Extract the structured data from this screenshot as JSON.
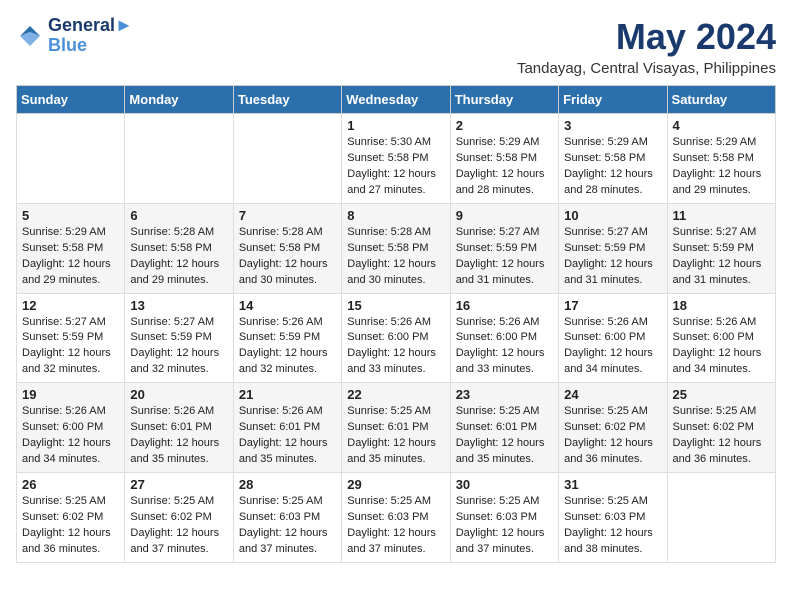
{
  "logo": {
    "line1": "General",
    "line2": "Blue"
  },
  "title": "May 2024",
  "subtitle": "Tandayag, Central Visayas, Philippines",
  "header": {
    "days": [
      "Sunday",
      "Monday",
      "Tuesday",
      "Wednesday",
      "Thursday",
      "Friday",
      "Saturday"
    ]
  },
  "weeks": [
    {
      "cells": [
        {
          "day": "",
          "info": ""
        },
        {
          "day": "",
          "info": ""
        },
        {
          "day": "",
          "info": ""
        },
        {
          "day": "1",
          "info": "Sunrise: 5:30 AM\nSunset: 5:58 PM\nDaylight: 12 hours\nand 27 minutes."
        },
        {
          "day": "2",
          "info": "Sunrise: 5:29 AM\nSunset: 5:58 PM\nDaylight: 12 hours\nand 28 minutes."
        },
        {
          "day": "3",
          "info": "Sunrise: 5:29 AM\nSunset: 5:58 PM\nDaylight: 12 hours\nand 28 minutes."
        },
        {
          "day": "4",
          "info": "Sunrise: 5:29 AM\nSunset: 5:58 PM\nDaylight: 12 hours\nand 29 minutes."
        }
      ]
    },
    {
      "cells": [
        {
          "day": "5",
          "info": "Sunrise: 5:29 AM\nSunset: 5:58 PM\nDaylight: 12 hours\nand 29 minutes."
        },
        {
          "day": "6",
          "info": "Sunrise: 5:28 AM\nSunset: 5:58 PM\nDaylight: 12 hours\nand 29 minutes."
        },
        {
          "day": "7",
          "info": "Sunrise: 5:28 AM\nSunset: 5:58 PM\nDaylight: 12 hours\nand 30 minutes."
        },
        {
          "day": "8",
          "info": "Sunrise: 5:28 AM\nSunset: 5:58 PM\nDaylight: 12 hours\nand 30 minutes."
        },
        {
          "day": "9",
          "info": "Sunrise: 5:27 AM\nSunset: 5:59 PM\nDaylight: 12 hours\nand 31 minutes."
        },
        {
          "day": "10",
          "info": "Sunrise: 5:27 AM\nSunset: 5:59 PM\nDaylight: 12 hours\nand 31 minutes."
        },
        {
          "day": "11",
          "info": "Sunrise: 5:27 AM\nSunset: 5:59 PM\nDaylight: 12 hours\nand 31 minutes."
        }
      ]
    },
    {
      "cells": [
        {
          "day": "12",
          "info": "Sunrise: 5:27 AM\nSunset: 5:59 PM\nDaylight: 12 hours\nand 32 minutes."
        },
        {
          "day": "13",
          "info": "Sunrise: 5:27 AM\nSunset: 5:59 PM\nDaylight: 12 hours\nand 32 minutes."
        },
        {
          "day": "14",
          "info": "Sunrise: 5:26 AM\nSunset: 5:59 PM\nDaylight: 12 hours\nand 32 minutes."
        },
        {
          "day": "15",
          "info": "Sunrise: 5:26 AM\nSunset: 6:00 PM\nDaylight: 12 hours\nand 33 minutes."
        },
        {
          "day": "16",
          "info": "Sunrise: 5:26 AM\nSunset: 6:00 PM\nDaylight: 12 hours\nand 33 minutes."
        },
        {
          "day": "17",
          "info": "Sunrise: 5:26 AM\nSunset: 6:00 PM\nDaylight: 12 hours\nand 34 minutes."
        },
        {
          "day": "18",
          "info": "Sunrise: 5:26 AM\nSunset: 6:00 PM\nDaylight: 12 hours\nand 34 minutes."
        }
      ]
    },
    {
      "cells": [
        {
          "day": "19",
          "info": "Sunrise: 5:26 AM\nSunset: 6:00 PM\nDaylight: 12 hours\nand 34 minutes."
        },
        {
          "day": "20",
          "info": "Sunrise: 5:26 AM\nSunset: 6:01 PM\nDaylight: 12 hours\nand 35 minutes."
        },
        {
          "day": "21",
          "info": "Sunrise: 5:26 AM\nSunset: 6:01 PM\nDaylight: 12 hours\nand 35 minutes."
        },
        {
          "day": "22",
          "info": "Sunrise: 5:25 AM\nSunset: 6:01 PM\nDaylight: 12 hours\nand 35 minutes."
        },
        {
          "day": "23",
          "info": "Sunrise: 5:25 AM\nSunset: 6:01 PM\nDaylight: 12 hours\nand 35 minutes."
        },
        {
          "day": "24",
          "info": "Sunrise: 5:25 AM\nSunset: 6:02 PM\nDaylight: 12 hours\nand 36 minutes."
        },
        {
          "day": "25",
          "info": "Sunrise: 5:25 AM\nSunset: 6:02 PM\nDaylight: 12 hours\nand 36 minutes."
        }
      ]
    },
    {
      "cells": [
        {
          "day": "26",
          "info": "Sunrise: 5:25 AM\nSunset: 6:02 PM\nDaylight: 12 hours\nand 36 minutes."
        },
        {
          "day": "27",
          "info": "Sunrise: 5:25 AM\nSunset: 6:02 PM\nDaylight: 12 hours\nand 37 minutes."
        },
        {
          "day": "28",
          "info": "Sunrise: 5:25 AM\nSunset: 6:03 PM\nDaylight: 12 hours\nand 37 minutes."
        },
        {
          "day": "29",
          "info": "Sunrise: 5:25 AM\nSunset: 6:03 PM\nDaylight: 12 hours\nand 37 minutes."
        },
        {
          "day": "30",
          "info": "Sunrise: 5:25 AM\nSunset: 6:03 PM\nDaylight: 12 hours\nand 37 minutes."
        },
        {
          "day": "31",
          "info": "Sunrise: 5:25 AM\nSunset: 6:03 PM\nDaylight: 12 hours\nand 38 minutes."
        },
        {
          "day": "",
          "info": ""
        }
      ]
    }
  ]
}
